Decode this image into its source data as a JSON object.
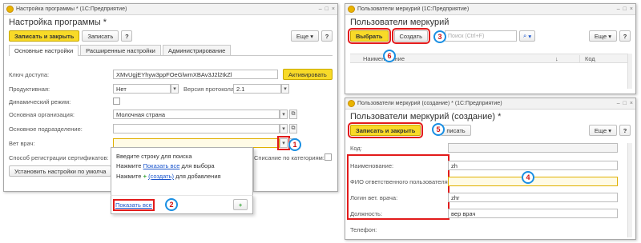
{
  "win1": {
    "titlebar": "Настройка программы * (1С:Предприятие)",
    "form_title": "Настройка программы *",
    "toolbar": {
      "save_close": "Записать и закрыть",
      "save": "Записать",
      "help": "?",
      "more": "Еще",
      "more_help": "?"
    },
    "tabs": [
      "Основные настройки",
      "Расширенные настройки",
      "Администрирование"
    ],
    "fields": {
      "access_key_label": "Ключ доступа:",
      "access_key_value": "XMvUgjEYhyw3ppFOeGlwmXBAv3J2l2tkZl",
      "activate": "Активировать",
      "product_label": "Продуктивная:",
      "product_value": "Нет",
      "protocol_label": "Версия протокола:",
      "protocol_value": "2.1",
      "dynamic_label": "Динамический режим:",
      "org_label": "Основная организация:",
      "org_value": "Молочная страна",
      "dept_label": "Основное подразделение:",
      "vet_label": "Вет врач:",
      "cert_label": "Способ регистрации сертификатов:",
      "writeoff_label": "Списание по категориям:",
      "default_btn": "Установить настройки по умолча"
    },
    "popup": {
      "line1": "Введите строку для поиска",
      "line2_prefix": "Нажмите",
      "line2_link": "Показать все",
      "line2_suffix": "для выбора",
      "line3_prefix": "Нажмите",
      "line3_link": "(создать)",
      "line3_suffix": "для добавления",
      "show_all": "Показать все",
      "plus": "+"
    }
  },
  "win2": {
    "titlebar": "Пользователи меркурий (1С:Предприятие)",
    "form_title": "Пользователи меркурий",
    "toolbar": {
      "select": "Выбрать",
      "create": "Создать",
      "search_placeholder": "Поиск (Ctrl+F)",
      "more": "Еще",
      "help": "?"
    },
    "columns": [
      "Наименование",
      "Код"
    ],
    "sort_arrow": "↓"
  },
  "win3": {
    "titlebar": "Пользователи меркурий (создание) * (1С:Предприятие)",
    "form_title": "Пользователи меркурий (создание) *",
    "toolbar": {
      "save_close": "Записать и закрыть",
      "save_partial": "писать",
      "more": "Еще",
      "help": "?"
    },
    "fields": {
      "code_label": "Код:",
      "name_label": "Наименование:",
      "name_value": "zh",
      "fio_label": "ФИО ответственного пользователя:",
      "fio_value": "",
      "login_label": "Логин вет. врача:",
      "login_value": "zhr",
      "position_label": "Должность:",
      "position_value": "вер врач",
      "phone_label": "Телефон:"
    }
  },
  "callouts": [
    "1",
    "2",
    "3",
    "4",
    "5",
    "6"
  ],
  "icons": {
    "dropdown": "▾",
    "open": "⧉",
    "search": "🔍",
    "clear": "×",
    "min": "–",
    "max": "□",
    "close": "×",
    "more_arrow": "▾"
  },
  "colors": {
    "accent_yellow": "#f8da28",
    "highlight_red": "#e21b1b",
    "callout_blue": "#1a8fe3"
  }
}
